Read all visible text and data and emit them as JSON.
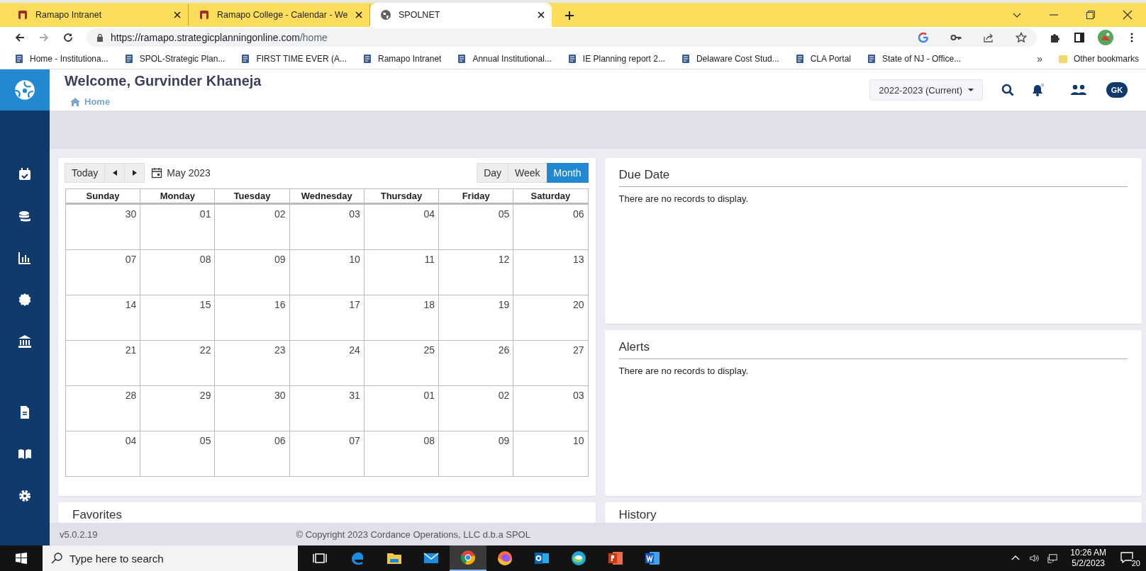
{
  "browser": {
    "tabs": [
      {
        "title": "Ramapo Intranet",
        "selected": false
      },
      {
        "title": "Ramapo College - Calendar - We",
        "selected": false
      },
      {
        "title": "SPOLNET",
        "selected": true
      }
    ],
    "url_host": "https://ramapo.strategicplanningonline.com",
    "url_path": "/home",
    "bookmarks": [
      "Home - Institutiona...",
      "SPOL-Strategic Plan...",
      "FIRST TIME EVER (A...",
      "Ramapo Intranet",
      "Annual Institutional...",
      "IE Planning report 2...",
      "Delaware Cost Stud...",
      "CLA Portal",
      "State of NJ - Office..."
    ],
    "overflow": "»",
    "other_bookmarks": "Other bookmarks"
  },
  "header": {
    "welcome": "Welcome, Gurvinder Khaneja",
    "breadcrumb": "Home",
    "year_selector": "2022-2023 (Current)",
    "avatar": "GK"
  },
  "calendar": {
    "today": "Today",
    "title": "May 2023",
    "views": [
      {
        "label": "Day",
        "selected": false
      },
      {
        "label": "Week",
        "selected": false
      },
      {
        "label": "Month",
        "selected": true
      }
    ],
    "weekdays": [
      "Sunday",
      "Monday",
      "Tuesday",
      "Wednesday",
      "Thursday",
      "Friday",
      "Saturday"
    ],
    "weeks": [
      [
        "30",
        "01",
        "02",
        "03",
        "04",
        "05",
        "06"
      ],
      [
        "07",
        "08",
        "09",
        "10",
        "11",
        "12",
        "13"
      ],
      [
        "14",
        "15",
        "16",
        "17",
        "18",
        "19",
        "20"
      ],
      [
        "21",
        "22",
        "23",
        "24",
        "25",
        "26",
        "27"
      ],
      [
        "28",
        "29",
        "30",
        "31",
        "01",
        "02",
        "03"
      ],
      [
        "04",
        "05",
        "06",
        "07",
        "08",
        "09",
        "10"
      ]
    ]
  },
  "due_date": {
    "title": "Due Date",
    "message": "There are no records to display."
  },
  "alerts": {
    "title": "Alerts",
    "message": "There are no records to display."
  },
  "favorites": {
    "title": "Favorites"
  },
  "history": {
    "title": "History"
  },
  "footer": {
    "version": "v5.0.2.19",
    "copyright": "© Copyright 2023 Cordance Operations, LLC d.b.a SPOL"
  },
  "taskbar": {
    "search_placeholder": "Type here to search",
    "apps": [
      {
        "kind": "taskview",
        "selected": false
      },
      {
        "kind": "edge",
        "selected": false
      },
      {
        "kind": "folder",
        "selected": false
      },
      {
        "kind": "mail",
        "selected": false
      },
      {
        "kind": "chrome",
        "selected": true
      },
      {
        "kind": "firefox",
        "selected": false
      },
      {
        "kind": "outlook",
        "selected": false
      },
      {
        "kind": "globe",
        "selected": false
      },
      {
        "kind": "powerpoint",
        "selected": false
      },
      {
        "kind": "word",
        "selected": false
      }
    ],
    "time": "10:26 AM",
    "date": "5/2/2023",
    "notifications": "20"
  }
}
